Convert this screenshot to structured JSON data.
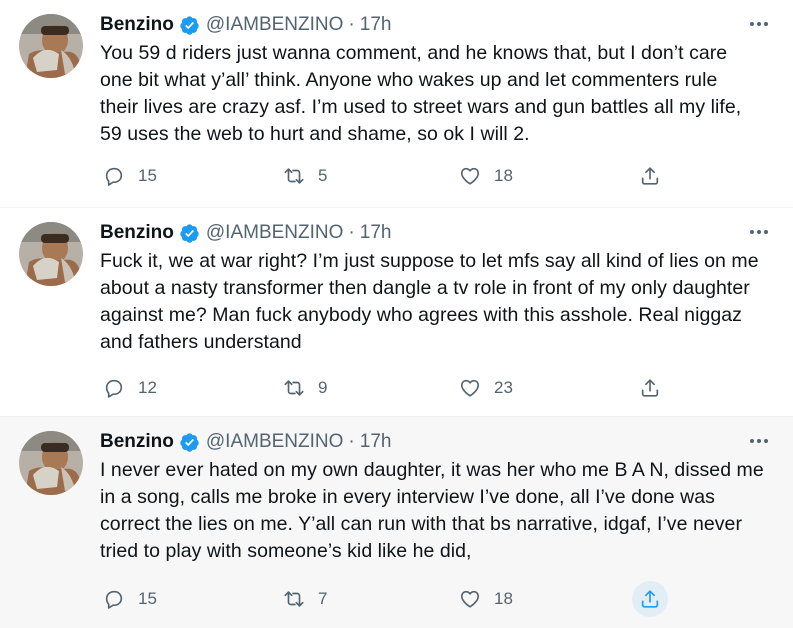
{
  "colors": {
    "text_primary": "#0f1419",
    "text_secondary": "#536471",
    "verified_blue": "#1d9bf0",
    "divider": "#eff3f4",
    "share_active_bg": "#e1eef6",
    "share_active_icon": "#1d9bf0"
  },
  "tweets": [
    {
      "author": {
        "name": "Benzino",
        "handle": "@IAMBENZINO",
        "verified": true
      },
      "dot": "·",
      "time": "17h",
      "text": "You 59 d riders just wanna comment, and he knows that, but I don’t care\none bit what y’all’ think. Anyone who wakes up and let commenters rule\ntheir lives are crazy asf. I’m used to street wars and gun battles all my life,\n59 uses the web to hurt and shame, so ok I will 2.",
      "stats": {
        "replies": "15",
        "retweets": "5",
        "likes": "18"
      },
      "icons": {
        "reply": "reply-icon",
        "retweet": "retweet-icon",
        "like": "heart-icon",
        "share": "share-icon",
        "more": "more-icon"
      }
    },
    {
      "author": {
        "name": "Benzino",
        "handle": "@IAMBENZINO",
        "verified": true
      },
      "dot": "·",
      "time": "17h",
      "text": "Fuck it, we at war right? I’m just suppose to let mfs say all kind of lies on me\nabout a nasty transformer then dangle a tv role in front of my only daughter\nagainst me? Man fuck anybody who agrees with this asshole. Real niggaz\nand fathers understand",
      "stats": {
        "replies": "12",
        "retweets": "9",
        "likes": "23"
      },
      "icons": {
        "reply": "reply-icon",
        "retweet": "retweet-icon",
        "like": "heart-icon",
        "share": "share-icon",
        "more": "more-icon"
      }
    },
    {
      "author": {
        "name": "Benzino",
        "handle": "@IAMBENZINO",
        "verified": true
      },
      "dot": "·",
      "time": "17h",
      "text": "I never ever hated on my own daughter, it was her who me B A N, dissed me\nin a song, calls me broke in every interview I’ve done, all I’ve done was\ncorrect the lies on me. Y’all can run with that bs narrative, idgaf, I’ve never\ntried to play with someone’s kid like he did,",
      "stats": {
        "replies": "15",
        "retweets": "7",
        "likes": "18"
      },
      "share_hovered": true,
      "icons": {
        "reply": "reply-icon",
        "retweet": "retweet-icon",
        "like": "heart-icon",
        "share": "share-icon",
        "more": "more-icon"
      }
    }
  ]
}
